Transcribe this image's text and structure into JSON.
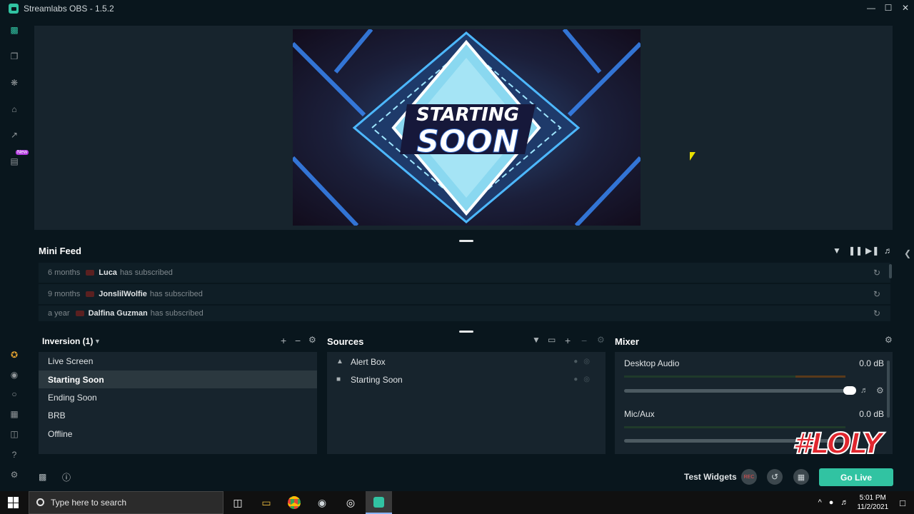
{
  "window": {
    "title": "Streamlabs OBS - 1.5.2"
  },
  "sidenav": {
    "new_badge": "New"
  },
  "minifeed": {
    "title": "Mini Feed",
    "items": [
      {
        "time": "6 months",
        "name": "Luca",
        "action": "has subscribed"
      },
      {
        "time": "9 months",
        "name": "JonslilWolfie",
        "action": "has subscribed"
      },
      {
        "time": "a year",
        "name": "Dalfina Guzman",
        "action": "has subscribed"
      }
    ]
  },
  "scenes": {
    "collection": "Inversion (1)",
    "items": [
      "Live Screen",
      "Starting Soon",
      "Ending Soon",
      "BRB",
      "Offline"
    ],
    "selected": "Starting Soon"
  },
  "sources": {
    "title": "Sources",
    "items": [
      {
        "icon": "bell-icon",
        "label": "Alert Box"
      },
      {
        "icon": "file-icon",
        "label": "Starting Soon"
      }
    ]
  },
  "mixer": {
    "title": "Mixer",
    "channels": [
      {
        "label": "Desktop Audio",
        "db": "0.0 dB",
        "volume": 1.0
      },
      {
        "label": "Mic/Aux",
        "db": "0.0 dB",
        "volume": 1.0
      }
    ]
  },
  "preview": {
    "line1": "STARTING",
    "line2": "SOON"
  },
  "footer": {
    "test_widgets": "Test Widgets",
    "rec": "REC",
    "go_live": "Go Live"
  },
  "overlay": {
    "tag": "#LOLY"
  },
  "taskbar": {
    "search_placeholder": "Type here to search",
    "time": "5:01 PM",
    "date": "11/2/2021"
  },
  "colors": {
    "accent": "#31c3a2",
    "background": "#09161d",
    "panel": "#17242d"
  }
}
